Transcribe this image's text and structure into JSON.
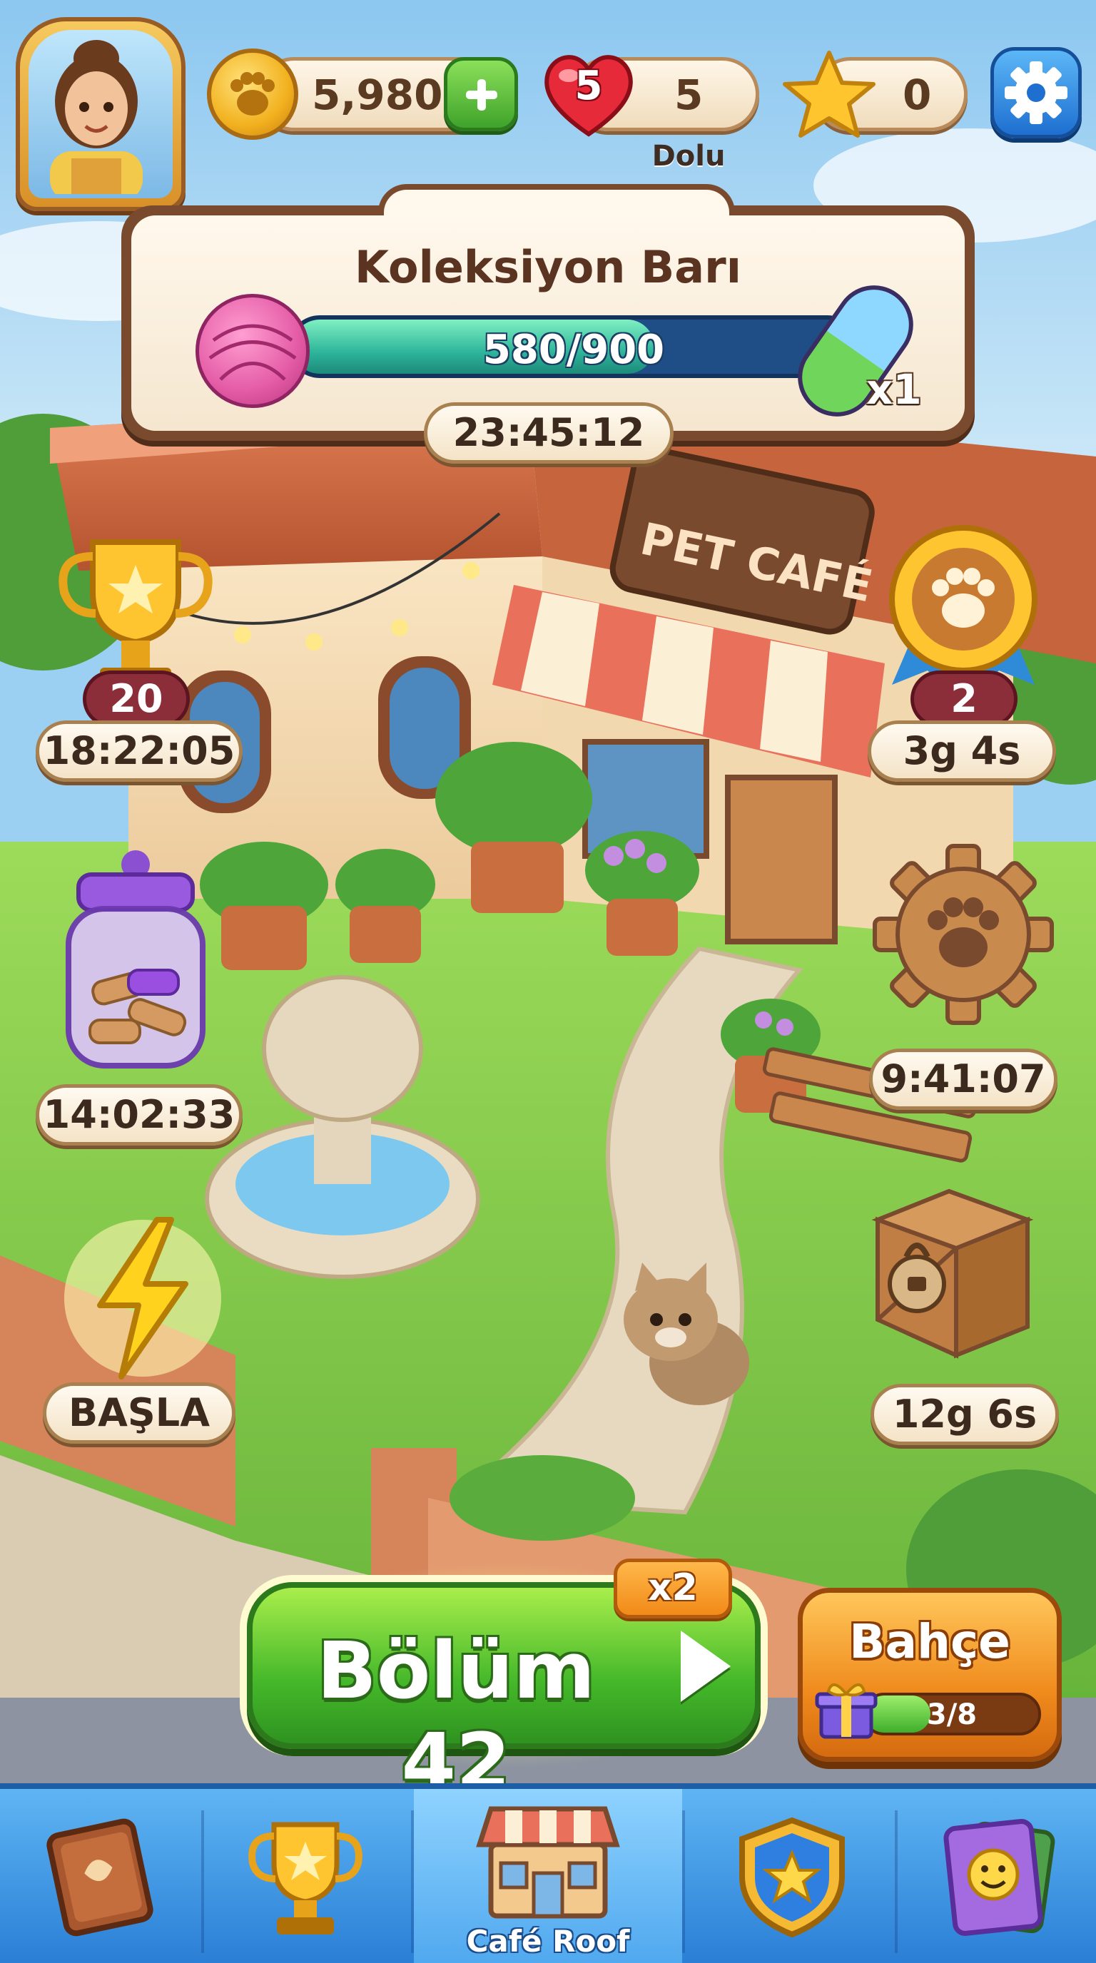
{
  "hud": {
    "coins": "5,980",
    "lives_badge": "5",
    "lives_count": "5",
    "lives_status": "Dolu",
    "stars": "0"
  },
  "collection": {
    "title": "Koleksiyon Barı",
    "progress_text": "580/900",
    "progress_fraction": 0.644,
    "reward_multiplier": "x1",
    "timer": "23:45:12"
  },
  "map_events": {
    "trophy": {
      "badge": "20",
      "timer": "18:22:05",
      "icon": "trophy-icon"
    },
    "paw_medal": {
      "badge": "2",
      "timer": "3g 4s",
      "icon": "paw-medal-icon"
    },
    "treat_jar": {
      "timer": "14:02:33",
      "icon": "treat-jar-icon"
    },
    "gear_event": {
      "timer": "9:41:07",
      "icon": "paw-gear-icon"
    },
    "lightning": {
      "label": "BAŞLA",
      "icon": "lightning-icon"
    },
    "locked_crate": {
      "timer": "12g 6s",
      "icon": "locked-crate-icon"
    }
  },
  "scene": {
    "sign": "PET CAFÉ"
  },
  "play": {
    "label": "Bölüm 42",
    "multiplier": "x2"
  },
  "garden": {
    "label": "Bahçe",
    "progress_text": "3/8",
    "progress_fraction": 0.375
  },
  "nav": {
    "items": [
      {
        "icon": "book-icon",
        "label": ""
      },
      {
        "icon": "trophy-icon",
        "label": ""
      },
      {
        "icon": "cafe-shop-icon",
        "label": "Café Roof",
        "active": true
      },
      {
        "icon": "shield-star-icon",
        "label": ""
      },
      {
        "icon": "cards-icon",
        "label": ""
      }
    ]
  },
  "colors": {
    "sky": "#9cd0f2",
    "grass": "#7fc94a",
    "play_green": "#45b82a",
    "garden_orange": "#f08b1d",
    "nav_blue": "#2a7fd6",
    "progress_teal": "#2eb59b"
  }
}
